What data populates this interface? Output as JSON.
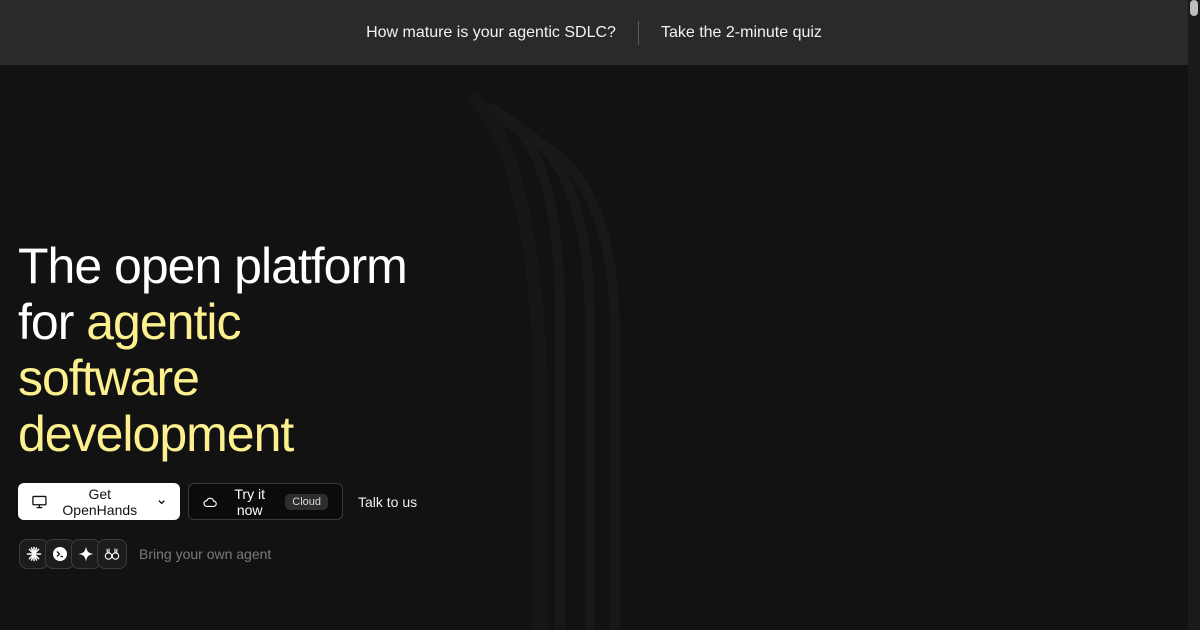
{
  "banner": {
    "question": "How mature is your agentic SDLC?",
    "link_label": "Take the 2-minute quiz"
  },
  "hero": {
    "title_line1": "The open platform",
    "title_line2_plain": "for ",
    "title_line2_accent": "agentic",
    "title_line3": "software",
    "title_line4": "development"
  },
  "cta": {
    "primary_label": "Get OpenHands",
    "primary_icon": "monitor-icon",
    "secondary_label": "Try it now",
    "secondary_icon": "cloud-icon",
    "secondary_badge": "Cloud",
    "talk_label": "Talk to us"
  },
  "agents": {
    "icons": [
      "sparkburst-icon",
      "terminal-bubble-icon",
      "four-point-star-icon",
      "hands-icon"
    ],
    "label": "Bring your own agent"
  },
  "colors": {
    "background": "#121212",
    "banner_bg": "#2a2a2a",
    "accent": "#fdf18f"
  }
}
